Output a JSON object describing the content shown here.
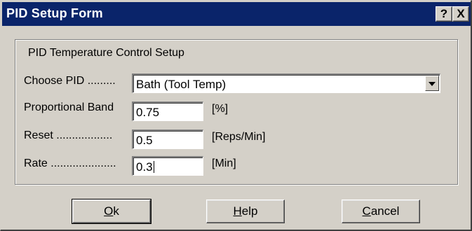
{
  "window": {
    "title": "PID Setup Form",
    "help_button": "?",
    "close_button": "X"
  },
  "group": {
    "title": "PID Temperature Control Setup"
  },
  "fields": {
    "choose_pid": {
      "label": "Choose PID .........",
      "value": "Bath (Tool Temp)"
    },
    "proportional_band": {
      "label": "Proportional Band",
      "value": "0.75",
      "unit": "[%]"
    },
    "reset": {
      "label": "Reset ..................",
      "value": "0.5",
      "unit": "[Reps/Min]"
    },
    "rate": {
      "label": "Rate .....................",
      "value": "0.3",
      "unit": "[Min]"
    }
  },
  "buttons": {
    "ok": {
      "mnemonic": "O",
      "rest": "k"
    },
    "help": {
      "mnemonic": "H",
      "rest": "elp"
    },
    "cancel": {
      "mnemonic": "C",
      "rest": "ancel"
    }
  },
  "colors": {
    "titlebar": "#0a246a",
    "face": "#d4d0c8"
  }
}
